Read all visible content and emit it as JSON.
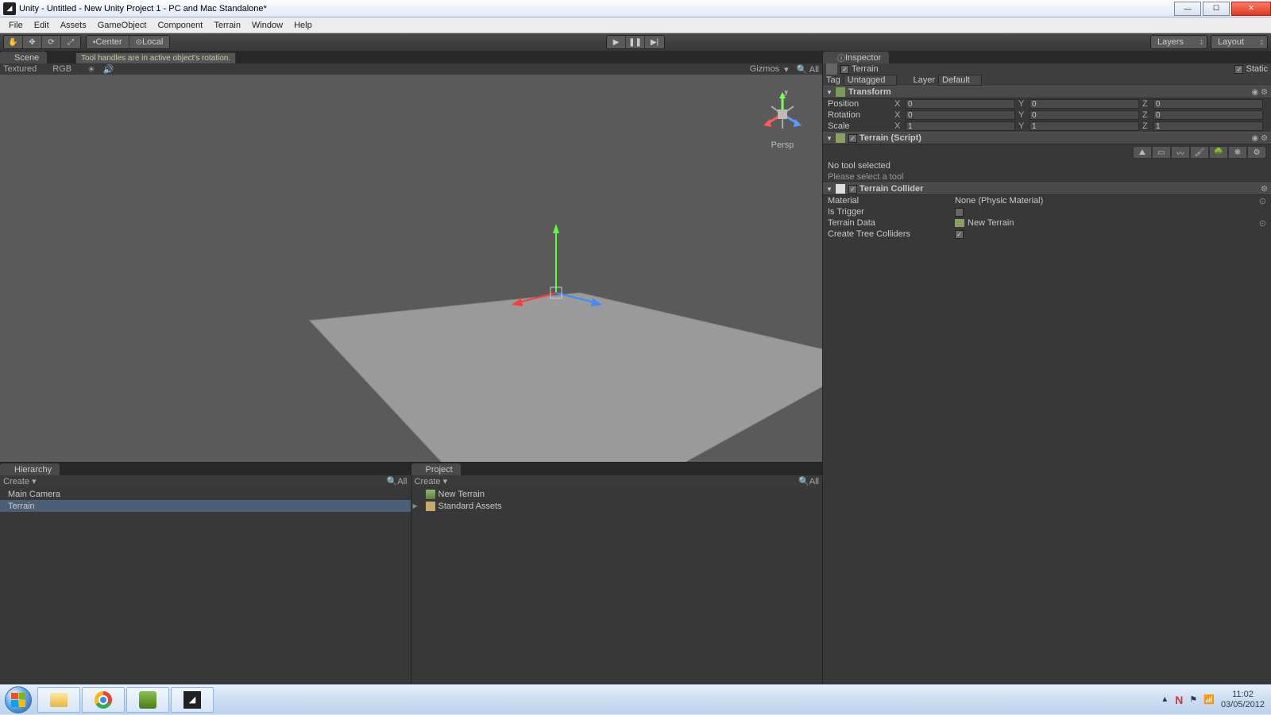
{
  "window": {
    "title": "Unity - Untitled - New Unity Project 1 - PC and Mac Standalone*"
  },
  "menu": [
    "File",
    "Edit",
    "Assets",
    "GameObject",
    "Component",
    "Terrain",
    "Window",
    "Help"
  ],
  "toolbar": {
    "pivot": "Center",
    "handle": "Local",
    "layers": "Layers",
    "layout": "Layout",
    "tooltip": "Tool handles are in active object's rotation."
  },
  "scene": {
    "tab": "Scene",
    "shading": "Textured",
    "light": "RGB",
    "gizmos": "Gizmos",
    "search_placeholder": "All",
    "persp": "Persp",
    "axes": {
      "x": "x",
      "y": "y",
      "z": "z"
    }
  },
  "hierarchy": {
    "tab": "Hierarchy",
    "create": "Create",
    "search_placeholder": "All",
    "items": [
      "Main Camera",
      "Terrain"
    ],
    "selected_index": 1
  },
  "project": {
    "tab": "Project",
    "create": "Create",
    "search_placeholder": "All",
    "items": [
      {
        "name": "New Terrain",
        "icon": "terrain",
        "expandable": false
      },
      {
        "name": "Standard Assets",
        "icon": "folder",
        "expandable": true
      }
    ]
  },
  "inspector": {
    "tab": "Inspector",
    "object_enabled": true,
    "object_name": "Terrain",
    "static_label": "Static",
    "tag_label": "Tag",
    "tag_value": "Untagged",
    "layer_label": "Layer",
    "layer_value": "Default",
    "transform": {
      "title": "Transform",
      "position": {
        "label": "Position",
        "x": "0",
        "y": "0",
        "z": "0"
      },
      "rotation": {
        "label": "Rotation",
        "x": "0",
        "y": "0",
        "z": "0"
      },
      "scale": {
        "label": "Scale",
        "x": "1",
        "y": "1",
        "z": "1"
      }
    },
    "terrain_script": {
      "title": "Terrain (Script)",
      "no_tool": "No tool selected",
      "hint": "Please select a tool"
    },
    "terrain_collider": {
      "title": "Terrain Collider",
      "material_label": "Material",
      "material_value": "None (Physic Material)",
      "is_trigger_label": "Is Trigger",
      "is_trigger": false,
      "terrain_data_label": "Terrain Data",
      "terrain_data_value": "New Terrain",
      "tree_colliders_label": "Create Tree Colliders",
      "tree_colliders": true
    }
  },
  "taskbar": {
    "time": "11:02",
    "date": "03/05/2012",
    "n_icon": "N"
  }
}
